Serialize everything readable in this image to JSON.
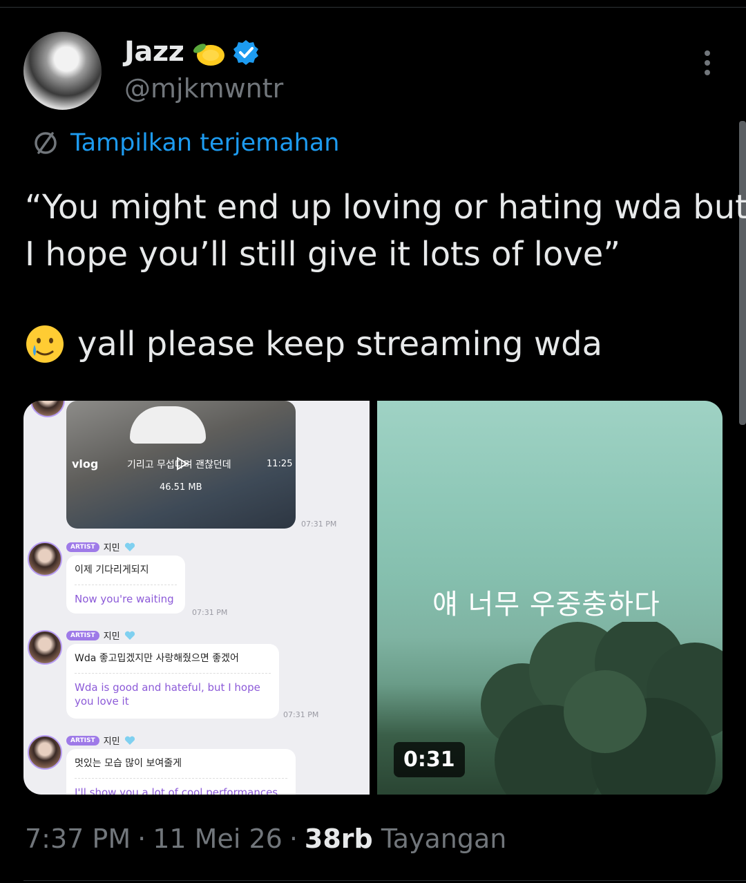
{
  "author": {
    "display_name": "Jazz",
    "handle": "@mjkmwntr",
    "name_emoji": "lemon-icon",
    "verified_icon": "verified-badge-icon"
  },
  "translate": {
    "label": "Tampilkan terjemahan"
  },
  "tweet": {
    "line1": "“You might end up loving or hating wda but",
    "line2": "I hope you’ll still give it lots of love”",
    "line3": "yall please keep streaming wda",
    "line3_emoji": "smiling-face-with-tear-icon"
  },
  "media_left": {
    "video": {
      "vlog": "vlog",
      "caption": "기리고 무섭다며 괜찮던데",
      "duration": "11:25",
      "size": "46.51 MB",
      "time": "07:31 PM"
    },
    "messages": [
      {
        "badge": "ARTIST",
        "name": "지민",
        "ko": "이제 기다리게되지",
        "en": "Now you're waiting",
        "time": "07:31 PM"
      },
      {
        "badge": "ARTIST",
        "name": "지민",
        "ko": "Wda 좋고밉겠지만 사랑해줬으면 좋겠어",
        "en": "Wda is good and hateful, but I hope you love it",
        "time": "07:31 PM"
      },
      {
        "badge": "ARTIST",
        "name": "지민",
        "ko": "멋있는 모습 많이 보여줄게",
        "en": "I'll show you a lot of cool performances"
      }
    ]
  },
  "media_right": {
    "caption": "얘 너무 우중충하다",
    "duration": "0:31"
  },
  "meta": {
    "time": "7:37 PM",
    "sep1": "·",
    "date": "11 Mei 26",
    "sep2": "·",
    "views": "38rb",
    "views_label": "Tayangan"
  }
}
